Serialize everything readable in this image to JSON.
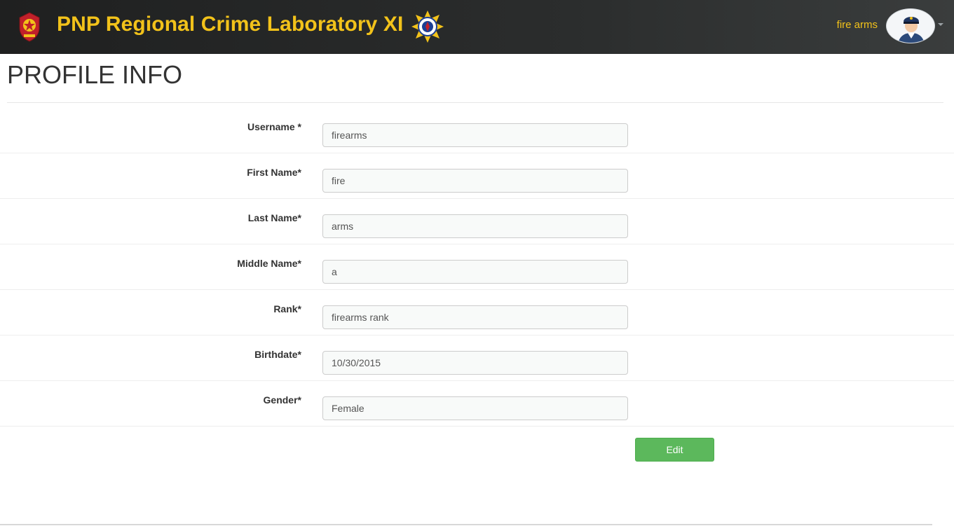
{
  "header": {
    "title": "PNP Regional Crime Laboratory XI",
    "user_name": "fire arms",
    "title_color": "#f2c21a",
    "left_logo_icon": "pnp-seal-icon",
    "right_logo_icon": "crime-lab-badge-icon",
    "avatar_icon": "police-officer-avatar-icon"
  },
  "page": {
    "title": "PROFILE INFO"
  },
  "form": {
    "fields": [
      {
        "label": "Username *",
        "value": "firearms"
      },
      {
        "label": "First Name*",
        "value": "fire"
      },
      {
        "label": "Last Name*",
        "value": "arms"
      },
      {
        "label": "Middle Name*",
        "value": "a"
      },
      {
        "label": "Rank*",
        "value": "firearms rank"
      },
      {
        "label": "Birthdate*",
        "value": "10/30/2015"
      },
      {
        "label": "Gender*",
        "value": "Female"
      }
    ],
    "edit_label": "Edit",
    "edit_color": "#5cb85c"
  }
}
